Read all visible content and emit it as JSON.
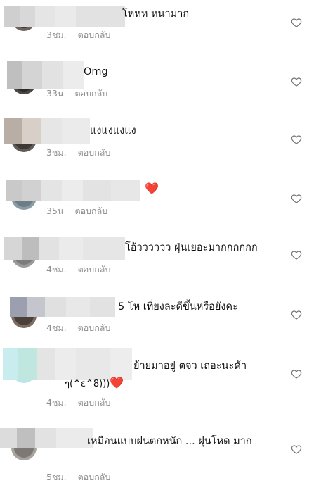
{
  "reply_label": "ตอบกลับ",
  "comments": [
    {
      "text": "โหหห หนามาก",
      "time": "3ชม."
    },
    {
      "text": "Omg",
      "time": "33น"
    },
    {
      "text": "แงแงแงแง",
      "time": "3ชม."
    },
    {
      "text": "",
      "heart": "❤️",
      "time": "35น"
    },
    {
      "text": "โอ้วววววว ฝุ่นเยอะมากกกกกก",
      "time": "4ชม."
    },
    {
      "text": "5 โห เที่ยงละดีขึ้นหรือยังคะ",
      "time": "4ชม."
    },
    {
      "text": "ย้ายมาอยู่ ตจว เถอะนะค้า",
      "text2": "ๆ(^ε^8)))",
      "heart": "❤️",
      "time": "4ชม."
    },
    {
      "text": "เหมือนแบบฝนตกหนัก ... ฝุ่นโหด มาก",
      "time": "5ชม."
    }
  ],
  "icons": {
    "like": "heart-outline-icon"
  },
  "colors": {
    "meta": "#8e8e8e",
    "heart": "#e0245e"
  }
}
